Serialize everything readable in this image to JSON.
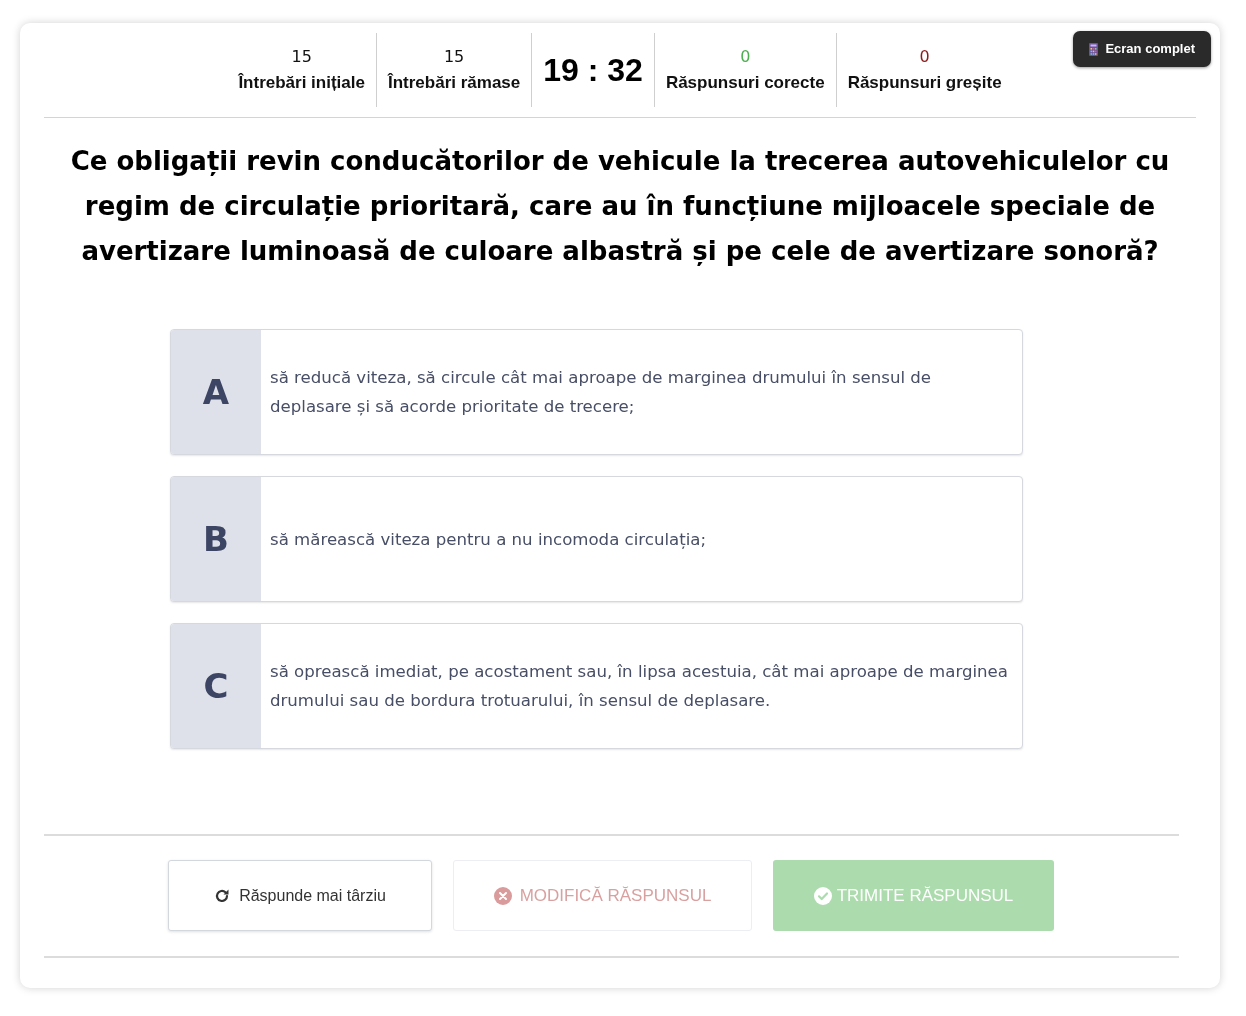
{
  "fullscreen_button": {
    "label": "Ecran complet"
  },
  "stats": [
    {
      "kind": "count",
      "value": "15",
      "label": "Întrebări inițiale"
    },
    {
      "kind": "count",
      "value": "15",
      "label": "Întrebări rămase"
    },
    {
      "kind": "timer",
      "value": "19 : 32"
    },
    {
      "kind": "correct",
      "value": "0",
      "label": "Răspunsuri corecte"
    },
    {
      "kind": "wrong",
      "value": "0",
      "label": "Răspunsuri greșite"
    }
  ],
  "question": "Ce obligații revin conducătorilor de vehicule la trecerea autovehiculelor cu regim de circulație prioritară, care au în funcțiune mijloacele speciale de avertizare luminoasă de culoare albastră și pe cele de avertizare sonoră?",
  "answers": [
    {
      "letter": "A",
      "text": "să reducă viteza, să circule cât mai aproape de marginea drumului în sensul de deplasare și să acorde prioritate de trecere;",
      "selected": false
    },
    {
      "letter": "B",
      "text": "să mărească viteza pentru a nu incomoda circulația;",
      "selected": false
    },
    {
      "letter": "C",
      "text": "să oprească imediat, pe acostament sau, în lipsa acestuia, cât mai aproape de marginea drumului sau de bordura trotuarului, în sensul de deplasare.",
      "selected": false
    }
  ],
  "actions": [
    {
      "kind": "later",
      "label": "Răspunde mai târziu",
      "disabled": false
    },
    {
      "kind": "modify",
      "label": "MODIFICĂ RĂSPUNSUL",
      "disabled": true
    },
    {
      "kind": "submit",
      "label": "TRIMITE RĂSPUNSUL",
      "disabled": true
    }
  ]
}
